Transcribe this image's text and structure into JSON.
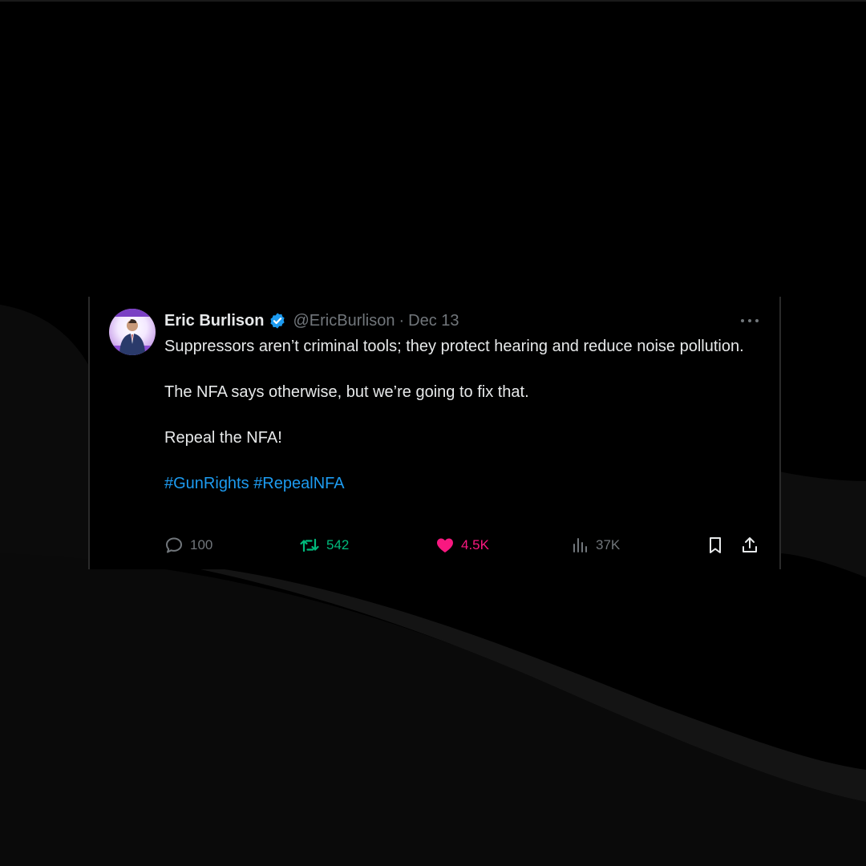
{
  "tweet": {
    "author_name": "Eric Burlison",
    "handle": "@EricBurlison",
    "separator": "·",
    "date": "Dec 13",
    "lines": [
      "Suppressors aren’t criminal tools; they protect hearing and reduce noise pollution.",
      "The NFA says otherwise, but we’re going to fix that.",
      "Repeal the NFA!"
    ],
    "hashtags": [
      "#GunRights",
      "#RepealNFA"
    ],
    "stats": {
      "replies": "100",
      "reposts": "542",
      "likes": "4.5K",
      "views": "37K"
    }
  },
  "icons": {
    "avatar": "profile-photo",
    "verified": "verified-badge-icon",
    "more": "more-options-icon",
    "reply": "reply-icon",
    "repost": "repost-icon",
    "like": "heart-icon",
    "views": "views-chart-icon",
    "bookmark": "bookmark-icon",
    "share": "share-icon"
  },
  "colors": {
    "background": "#000000",
    "text": "#e7e9ea",
    "muted": "#71767b",
    "link": "#1d9bf0",
    "repost": "#00ba7c",
    "like": "#f91880",
    "verified": "#1d9bf0"
  }
}
